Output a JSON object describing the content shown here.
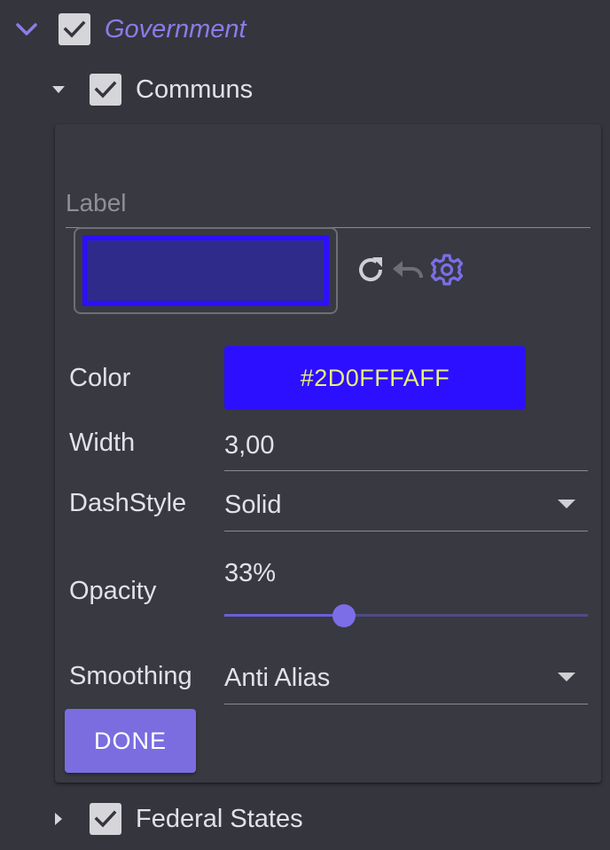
{
  "tree": {
    "government": {
      "label": "Government",
      "checked": true,
      "expanded": true
    },
    "communs": {
      "label": "Communs",
      "checked": true,
      "expanded": true
    },
    "federal_states": {
      "label": "Federal States",
      "checked": true,
      "expanded": false
    }
  },
  "style_panel": {
    "label_placeholder": "Label",
    "label_value": "",
    "preview": {
      "line_color": "#2D0FFF",
      "fill_color": "#2e2b8a"
    },
    "tools": [
      "refresh-icon",
      "undo-icon",
      "settings-gear-icon"
    ],
    "color": {
      "label": "Color",
      "value": "#2D0FFFAFF",
      "hex": "#2D0FFF",
      "text_color": "#e8f07a"
    },
    "width": {
      "label": "Width",
      "value": "3,00"
    },
    "dash_style": {
      "label": "DashStyle",
      "value": "Solid"
    },
    "opacity": {
      "label": "Opacity",
      "value_text": "33%",
      "value": 0.33
    },
    "smoothing": {
      "label": "Smoothing",
      "value": "Anti Alias"
    },
    "done_label": "DONE"
  },
  "colors": {
    "accent": "#7b6de0",
    "background": "#35353e",
    "panel": "#393942"
  }
}
